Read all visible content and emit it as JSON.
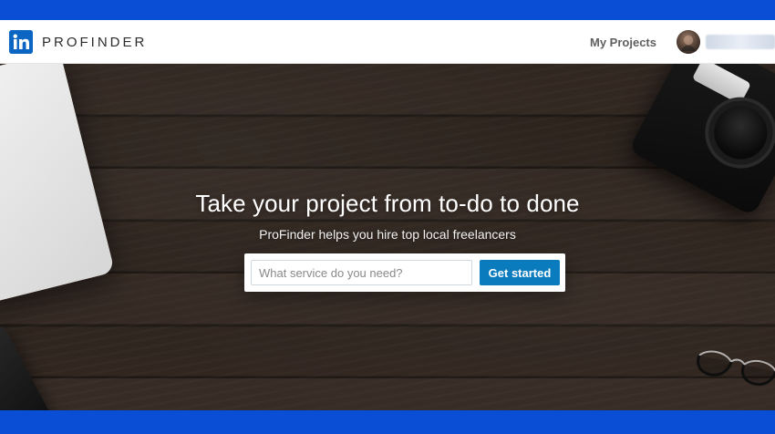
{
  "app": {
    "brand": "PROFINDER",
    "linkedin_badge_text": "in",
    "colors": {
      "frame_blue": "#0b4ed6",
      "linkedin_blue": "#0a66c2",
      "cta_blue": "#0a7bbd",
      "topbar_bg": "#ffffff",
      "hero_wood": "#3b2f28"
    }
  },
  "topbar": {
    "links": {
      "my_projects": "My Projects"
    },
    "account": {
      "avatar_icon": "user-avatar-icon",
      "name_redacted": true
    }
  },
  "hero": {
    "title": "Take your project from to-do to done",
    "subtitle": "ProFinder helps you hire top local freelancers",
    "search": {
      "placeholder": "What service do you need?",
      "value": ""
    },
    "cta": {
      "label": "Get started"
    }
  }
}
